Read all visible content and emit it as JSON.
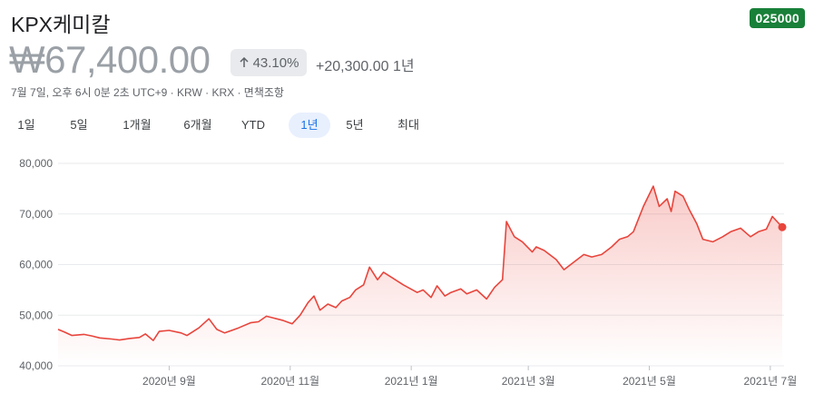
{
  "header": {
    "name": "KPX케미칼",
    "ticker": "025000",
    "price": "₩67,400.00",
    "change_pct": "43.10%",
    "change_abs": "+20,300.00 1년",
    "meta": "7월 7일, 오후 6시 0분 2초 UTC+9 · KRW · KRX · 면책조항"
  },
  "ranges": [
    {
      "label": "1일",
      "active": false
    },
    {
      "label": "5일",
      "active": false
    },
    {
      "label": "1개월",
      "active": false
    },
    {
      "label": "6개월",
      "active": false
    },
    {
      "label": "YTD",
      "active": false
    },
    {
      "label": "1년",
      "active": true
    },
    {
      "label": "5년",
      "active": false
    },
    {
      "label": "최대",
      "active": false
    }
  ],
  "colors": {
    "line": "#e8453c",
    "ticker_bg": "#188038",
    "active_range": "#1a73e8"
  },
  "chart_data": {
    "type": "area",
    "title": "",
    "xlabel": "",
    "ylabel": "",
    "ylim": [
      40000,
      80000
    ],
    "yticks": [
      80000,
      70000,
      60000,
      50000,
      40000
    ],
    "ytick_labels": [
      "80,000",
      "70,000",
      "60,000",
      "50,000",
      "40,000"
    ],
    "xticks": [
      {
        "date": "2020-09-01",
        "label": "2020년 9월"
      },
      {
        "date": "2020-11-01",
        "label": "2020년 11월"
      },
      {
        "date": "2021-01-01",
        "label": "2021년 1월"
      },
      {
        "date": "2021-03-01",
        "label": "2021년 3월"
      },
      {
        "date": "2021-05-01",
        "label": "2021년 5월"
      },
      {
        "date": "2021-07-01",
        "label": "2021년 7월"
      }
    ],
    "xrange": [
      "2020-07-07",
      "2021-07-07"
    ],
    "grid": true,
    "series": [
      {
        "points": [
          [
            "2020-07-07",
            47200
          ],
          [
            "2020-07-10",
            46700
          ],
          [
            "2020-07-14",
            46000
          ],
          [
            "2020-07-20",
            46200
          ],
          [
            "2020-07-24",
            45900
          ],
          [
            "2020-07-28",
            45500
          ],
          [
            "2020-08-03",
            45300
          ],
          [
            "2020-08-07",
            45100
          ],
          [
            "2020-08-12",
            45400
          ],
          [
            "2020-08-17",
            45600
          ],
          [
            "2020-08-20",
            46300
          ],
          [
            "2020-08-24",
            45000
          ],
          [
            "2020-08-27",
            46800
          ],
          [
            "2020-09-01",
            47000
          ],
          [
            "2020-09-07",
            46500
          ],
          [
            "2020-09-10",
            46000
          ],
          [
            "2020-09-16",
            47500
          ],
          [
            "2020-09-21",
            49300
          ],
          [
            "2020-09-25",
            47200
          ],
          [
            "2020-09-29",
            46500
          ],
          [
            "2020-10-06",
            47500
          ],
          [
            "2020-10-12",
            48500
          ],
          [
            "2020-10-16",
            48700
          ],
          [
            "2020-10-20",
            49800
          ],
          [
            "2020-10-23",
            49500
          ],
          [
            "2020-10-28",
            49000
          ],
          [
            "2020-11-02",
            48300
          ],
          [
            "2020-11-06",
            50000
          ],
          [
            "2020-11-10",
            52500
          ],
          [
            "2020-11-13",
            53800
          ],
          [
            "2020-11-16",
            51000
          ],
          [
            "2020-11-20",
            52200
          ],
          [
            "2020-11-24",
            51500
          ],
          [
            "2020-11-27",
            52800
          ],
          [
            "2020-12-01",
            53500
          ],
          [
            "2020-12-04",
            55000
          ],
          [
            "2020-12-08",
            56000
          ],
          [
            "2020-12-11",
            59500
          ],
          [
            "2020-12-15",
            57000
          ],
          [
            "2020-12-18",
            58500
          ],
          [
            "2020-12-22",
            57500
          ],
          [
            "2020-12-28",
            56000
          ],
          [
            "2021-01-04",
            54500
          ],
          [
            "2021-01-07",
            55000
          ],
          [
            "2021-01-11",
            53500
          ],
          [
            "2021-01-14",
            55800
          ],
          [
            "2021-01-18",
            53800
          ],
          [
            "2021-01-21",
            54500
          ],
          [
            "2021-01-26",
            55200
          ],
          [
            "2021-01-29",
            54200
          ],
          [
            "2021-02-03",
            55000
          ],
          [
            "2021-02-08",
            53200
          ],
          [
            "2021-02-12",
            55500
          ],
          [
            "2021-02-16",
            57000
          ],
          [
            "2021-02-18",
            68500
          ],
          [
            "2021-02-22",
            65500
          ],
          [
            "2021-02-26",
            64500
          ],
          [
            "2021-03-03",
            62500
          ],
          [
            "2021-03-05",
            63500
          ],
          [
            "2021-03-09",
            62800
          ],
          [
            "2021-03-15",
            61000
          ],
          [
            "2021-03-19",
            59000
          ],
          [
            "2021-03-24",
            60500
          ],
          [
            "2021-03-29",
            62000
          ],
          [
            "2021-04-02",
            61500
          ],
          [
            "2021-04-07",
            62000
          ],
          [
            "2021-04-12",
            63500
          ],
          [
            "2021-04-16",
            65000
          ],
          [
            "2021-04-20",
            65500
          ],
          [
            "2021-04-23",
            66500
          ],
          [
            "2021-04-28",
            71500
          ],
          [
            "2021-05-03",
            75500
          ],
          [
            "2021-05-06",
            71500
          ],
          [
            "2021-05-10",
            73000
          ],
          [
            "2021-05-12",
            70500
          ],
          [
            "2021-05-14",
            74500
          ],
          [
            "2021-05-18",
            73500
          ],
          [
            "2021-05-21",
            71000
          ],
          [
            "2021-05-25",
            68000
          ],
          [
            "2021-05-28",
            65000
          ],
          [
            "2021-06-02",
            64500
          ],
          [
            "2021-06-07",
            65500
          ],
          [
            "2021-06-11",
            66500
          ],
          [
            "2021-06-16",
            67200
          ],
          [
            "2021-06-21",
            65500
          ],
          [
            "2021-06-25",
            66500
          ],
          [
            "2021-06-29",
            67000
          ],
          [
            "2021-07-02",
            69500
          ],
          [
            "2021-07-07",
            67400
          ]
        ]
      }
    ]
  }
}
